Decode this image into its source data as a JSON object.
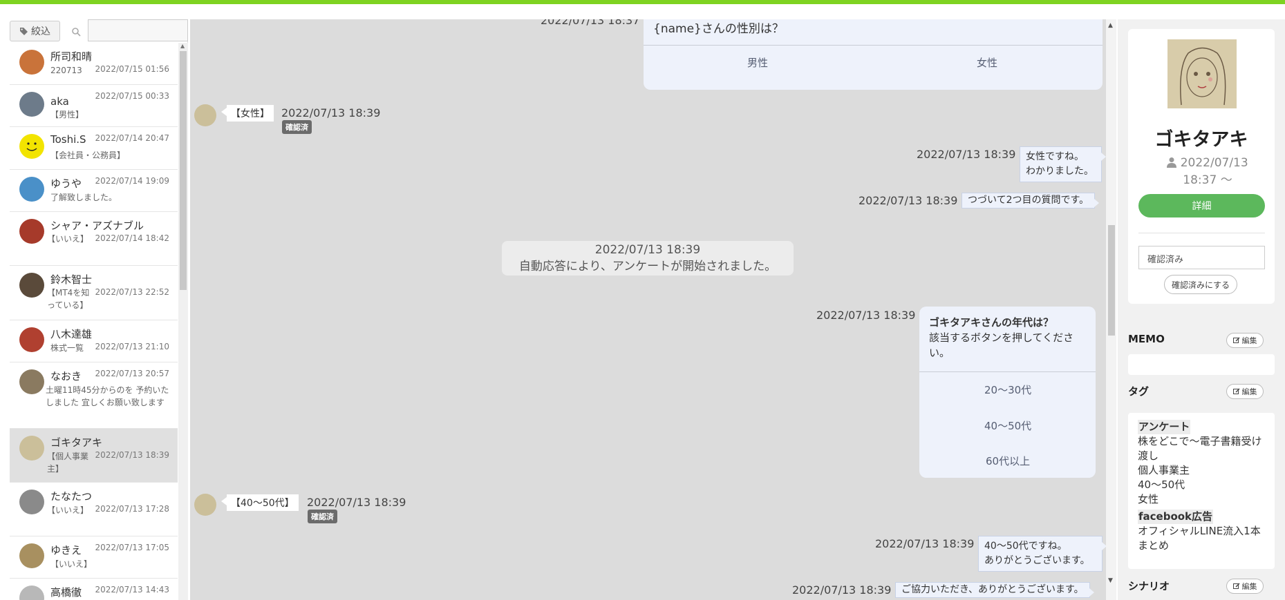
{
  "filter": {
    "label": "絞込",
    "search_placeholder": ""
  },
  "contacts": [
    {
      "name": "所司和晴",
      "sub": "220713",
      "date": "2022/07/15 01:56",
      "color": "#c9733a"
    },
    {
      "name": "aka",
      "sub": "【男性】",
      "date": "2022/07/15 00:33",
      "color": "#6d7b8a"
    },
    {
      "name": "Toshi.S",
      "sub": "【会社員・公務員】",
      "date": "2022/07/14 20:47",
      "color": "#f2e400"
    },
    {
      "name": "ゆうや",
      "sub": "了解致しました。",
      "date": "2022/07/14 19:09",
      "color": "#4a90c8"
    },
    {
      "name": "シャア・アズナブル",
      "sub": "【いいえ】",
      "date": "2022/07/14 18:42",
      "color": "#a63a2a"
    },
    {
      "name": "鈴木智士",
      "sub": "【MT4を知っている】",
      "date": "2022/07/13 22:52",
      "color": "#5a4a3a"
    },
    {
      "name": "八木達雄",
      "sub": "株式一覧",
      "date": "2022/07/13 21:10",
      "color": "#b04030"
    },
    {
      "name": "なおき",
      "sub": "土曜11時45分からのを 予約いたしました 宜しくお願い致します",
      "date": "2022/07/13 20:57",
      "color": "#8a7a60"
    },
    {
      "name": "ゴキタアキ",
      "sub": "【個人事業主】",
      "date": "2022/07/13 18:39",
      "color": "#cbbf9a"
    },
    {
      "name": "たなたつ",
      "sub": "【いいえ】",
      "date": "2022/07/13 17:28",
      "color": "#8a8a8a"
    },
    {
      "name": "ゆきえ",
      "sub": "【いいえ】",
      "date": "2022/07/13 17:05",
      "color": "#a89060"
    },
    {
      "name": "高橋徹",
      "sub": "",
      "date": "2022/07/13 14:43",
      "color": "#b8b8b8"
    }
  ],
  "chat": {
    "top_card": {
      "time": "2022/07/13 18:37",
      "question": "{name}さんの性別は？",
      "options": [
        "男性",
        "女性"
      ]
    },
    "reply1": {
      "text": "【女性】",
      "time": "2022/07/13 18:39",
      "badge": "確認済"
    },
    "msg1": {
      "time": "2022/07/13 18:39",
      "line1": "女性ですね。",
      "line2": "わかりました。"
    },
    "msg2": {
      "time": "2022/07/13 18:39",
      "text": "つづいて2つ目の質問です。"
    },
    "system": {
      "time": "2022/07/13 18:39",
      "text": "自動応答により、アンケートが開始されました。"
    },
    "card2": {
      "time": "2022/07/13 18:39",
      "title": "ゴキタアキさんの年代は？",
      "body": "該当するボタンを押してください。",
      "options": [
        "20〜30代",
        "40〜50代",
        "60代以上"
      ]
    },
    "reply2": {
      "text": "【40〜50代】",
      "time": "2022/07/13 18:39",
      "badge": "確認済"
    },
    "msg3": {
      "time": "2022/07/13 18:39",
      "line1": "40〜50代ですね。",
      "line2": "ありがとうございます。"
    },
    "msg4": {
      "time": "2022/07/13 18:39",
      "text": "ご協力いただき、ありがとうございます。"
    }
  },
  "profile": {
    "name": "ゴキタアキ",
    "since_line1": "2022/07/13",
    "since_line2": "18:37 〜",
    "detail_label": "詳細",
    "status_value": "確認済み",
    "confirm_label": "確認済みにする"
  },
  "sections": {
    "memo": "MEMO",
    "tag": "タグ",
    "scenario": "シナリオ",
    "edit_label": "編集"
  },
  "tags": {
    "group1": "アンケート",
    "group1_items": [
      "株をどこで〜電子書籍受け渡し",
      "個人事業主",
      "40〜50代",
      "女性"
    ],
    "group2": "facebook広告",
    "group2_items": [
      "オフィシャルLINE流入1本まとめ"
    ]
  },
  "colors": {
    "accent_green": "#7ed321",
    "detail_button": "#5cb85c",
    "badge": "#6b6b6b"
  }
}
